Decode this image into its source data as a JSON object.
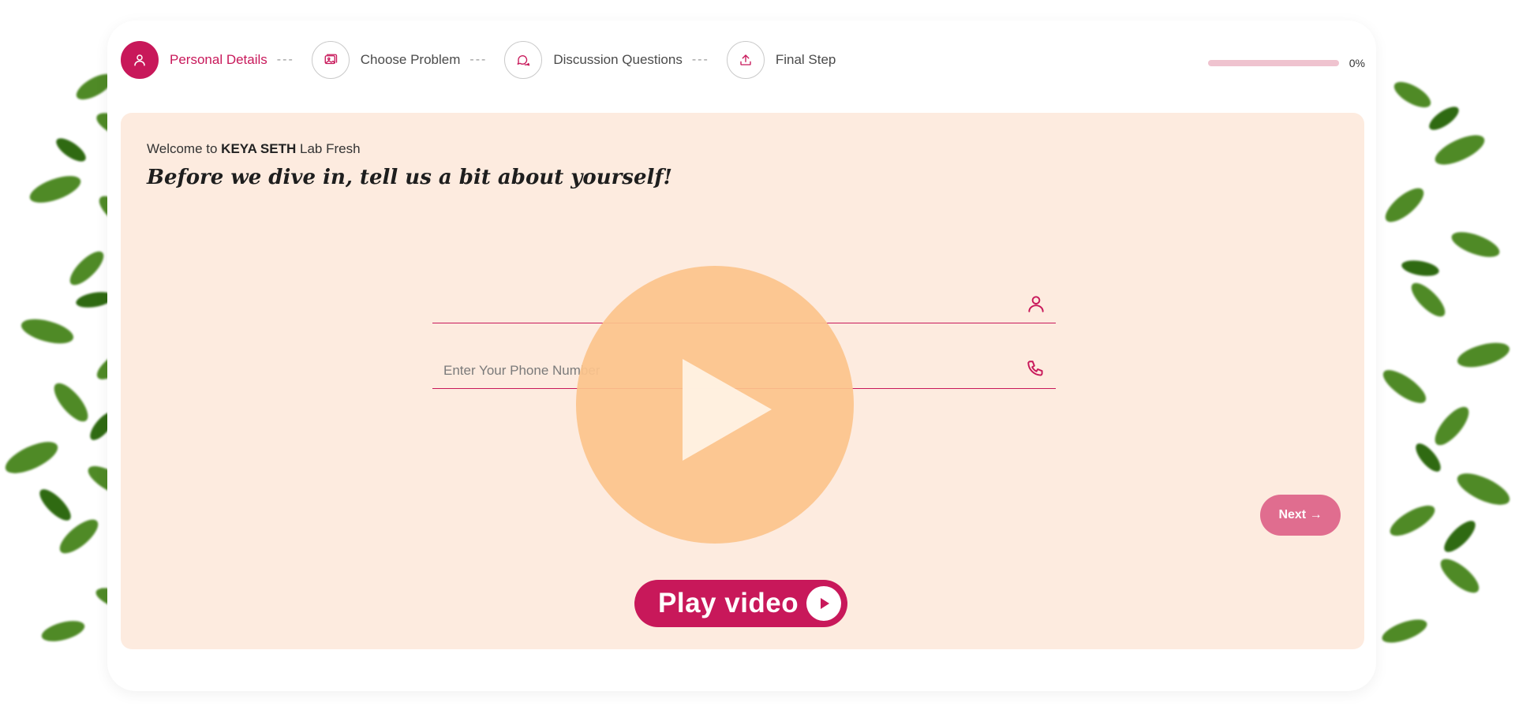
{
  "colors": {
    "accent": "#c8185a",
    "panel_bg": "#fdebdf",
    "progress_track": "#efc3cf",
    "overlay": "#fcc48c",
    "next_button": "#e06d8f"
  },
  "stepper": {
    "steps": [
      {
        "label": "Personal Details",
        "icon": "user-icon",
        "dash": "---"
      },
      {
        "label": "Choose Problem",
        "icon": "image-icon",
        "dash": "---"
      },
      {
        "label": "Discussion Questions",
        "icon": "chat-icon",
        "dash": "---"
      },
      {
        "label": "Final Step",
        "icon": "upload-icon"
      }
    ],
    "progress_text": "0%",
    "progress_value": 0
  },
  "panel": {
    "welcome_prefix": "Welcome to ",
    "welcome_brand": "KEYA SETH",
    "welcome_suffix": " Lab Fresh",
    "headline": "Before we dive in, tell us a bit about yourself!",
    "name_field": {
      "value": "",
      "placeholder": "",
      "icon": "user-icon"
    },
    "phone_field": {
      "value": "",
      "placeholder": "Enter Your Phone Number",
      "icon": "phone-icon"
    },
    "play_label": "Play video",
    "next_label": "Next →"
  }
}
